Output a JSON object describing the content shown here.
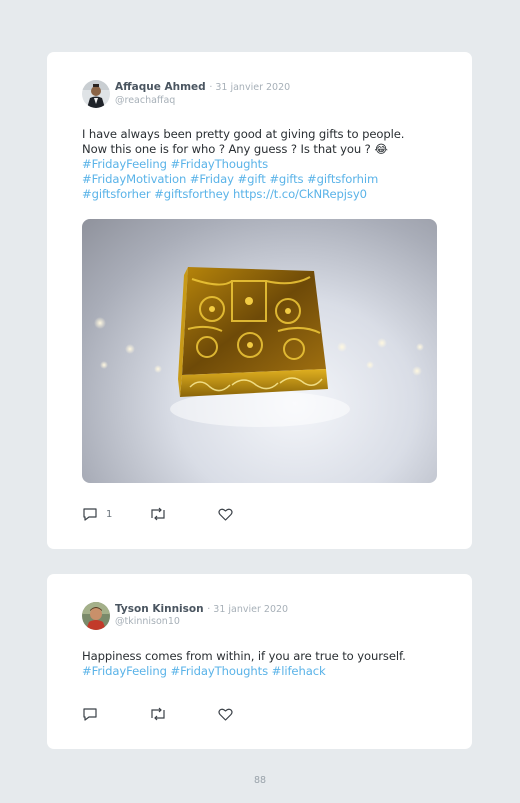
{
  "tweets": [
    {
      "author": "Affaque Ahmed",
      "date": "· 31 janvier 2020",
      "handle": "@reachaffaq",
      "text": {
        "line1": "I have always been pretty good at giving gifts to people.",
        "line2_text": "Now this one is for who ? Any guess ? Is that you ? ",
        "emoji": "😂",
        "tags_line1": "#FridayFeeling #FridayThoughts",
        "tags_line2": "#FridayMotivation #Friday #gift #gifts #giftsforhim",
        "tags_line3": "#giftsforher #giftsforthey https://t.co/CkNRepjsy0"
      },
      "reply_count": "1",
      "retweet_count": "",
      "like_count": ""
    },
    {
      "author": "Tyson Kinnison",
      "date": "· 31 janvier 2020",
      "handle": "@tkinnison10",
      "text": {
        "line1": "Happiness comes from within, if you are true to yourself.",
        "tags_line1": "#FridayFeeling #FridayThoughts #lifehack"
      },
      "reply_count": "",
      "retweet_count": "",
      "like_count": ""
    }
  ],
  "page_number": "88",
  "icons": [
    "reply-icon",
    "retweet-icon",
    "like-icon"
  ],
  "colors": {
    "hashtag": "#5ab3e8",
    "background": "#e6eaed",
    "card": "#ffffff"
  }
}
